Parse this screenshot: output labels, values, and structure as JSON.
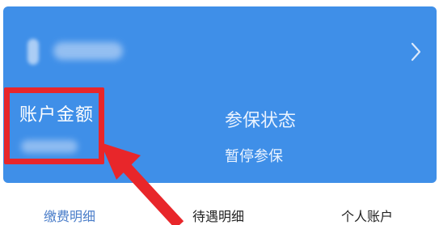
{
  "card": {
    "balance_label": "账户金额",
    "status_label": "参保状态",
    "status_value": "暂停参保"
  },
  "tabs": [
    {
      "label": "缴费明细",
      "active": true
    },
    {
      "label": "待遇明细",
      "active": false
    },
    {
      "label": "个人账户",
      "active": false
    }
  ],
  "icons": [
    "chevron-right-icon"
  ],
  "colors": {
    "card_bg": "#3f8fe8",
    "highlight": "#e8262a",
    "active_tab": "#4a7dc9"
  }
}
